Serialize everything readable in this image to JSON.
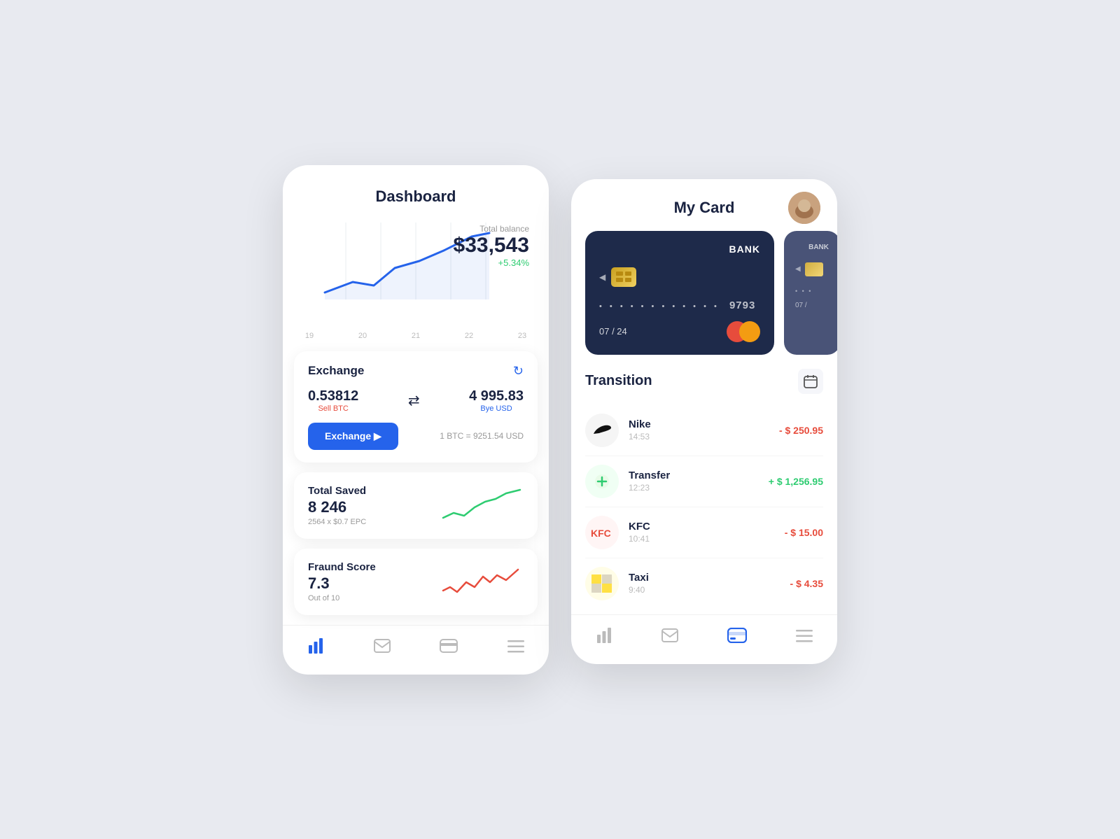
{
  "dashboard": {
    "title": "Dashboard",
    "balance": {
      "label": "Total balance",
      "amount": "$33,543",
      "change": "+5.34%"
    },
    "chart": {
      "x_labels": [
        "19",
        "20",
        "21",
        "22",
        "23"
      ]
    },
    "exchange": {
      "title": "Exchange",
      "sell_amount": "0.53812",
      "sell_label": "Sell BTC",
      "buy_amount": "4 995.83",
      "buy_label": "Bye USD",
      "button": "Exchange ▶",
      "rate": "1 BTC = 9251.54 USD"
    },
    "total_saved": {
      "label": "Total Saved",
      "value": "8 246",
      "sub": "2564 x $0.7 EPC"
    },
    "fraud_score": {
      "label": "Fraund Score",
      "value": "7.3",
      "sub": "Out of 10"
    },
    "nav": {
      "items": [
        "bar-chart-icon",
        "mail-icon",
        "card-icon",
        "menu-icon"
      ]
    }
  },
  "mycard": {
    "title": "My Card",
    "card": {
      "bank_label": "BANK",
      "dots": "• • • •  • • • •  • • • •",
      "last_four": "9793",
      "expiry": "07 / 24"
    },
    "transition_title": "Transition",
    "transactions": [
      {
        "icon": "nike",
        "name": "Nike",
        "time": "14:53",
        "amount": "- $ 250.95",
        "type": "negative"
      },
      {
        "icon": "transfer",
        "name": "Transfer",
        "time": "12:23",
        "amount": "+ $ 1,256.95",
        "type": "positive"
      },
      {
        "icon": "kfc",
        "name": "KFC",
        "time": "10:41",
        "amount": "- $ 15.00",
        "type": "negative"
      },
      {
        "icon": "taxi",
        "name": "Taxi",
        "time": "9:40",
        "amount": "- $ 4.35",
        "type": "negative"
      }
    ],
    "nav": {
      "items": [
        "bar-chart-icon",
        "mail-icon",
        "card-icon",
        "menu-icon"
      ],
      "active": 2
    }
  }
}
